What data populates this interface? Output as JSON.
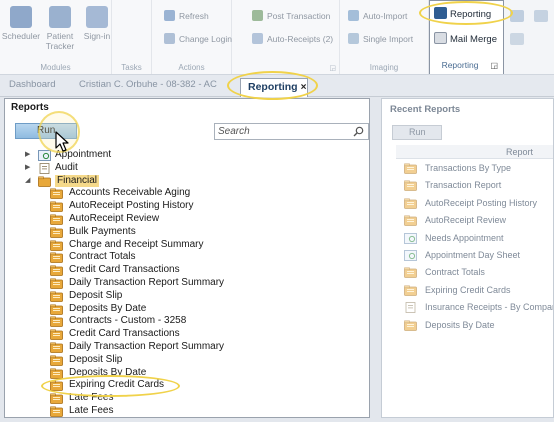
{
  "ribbon": {
    "groups": [
      {
        "label": "Modules",
        "buttons": [
          "Scheduler",
          "Patient Tracker",
          "Sign-in"
        ]
      },
      {
        "label": "Tasks"
      },
      {
        "label": "Actions",
        "items": [
          "Refresh",
          "Change Login"
        ]
      },
      {
        "label": "",
        "items": [
          "Post Transaction",
          "Auto-Receipts (2)"
        ]
      },
      {
        "label": "Imaging",
        "items": [
          "Auto-Import",
          "Single Import"
        ]
      }
    ],
    "reporting_group": {
      "label": "Reporting",
      "reporting_button": "Reporting",
      "mail_merge_button": "Mail Merge"
    }
  },
  "tabbar": {
    "crumbs": [
      "Dashboard",
      "Cristian C. Orbuhe - 08-382 - AC"
    ],
    "active_tab": "Reporting",
    "close_glyph": "×"
  },
  "reports": {
    "title": "Reports",
    "run_label": "Run",
    "search_placeholder": "Search",
    "tree": [
      {
        "label": "Appointment",
        "level": 1,
        "toggle": "▶",
        "icon": "appointment-icon"
      },
      {
        "label": "Audit",
        "level": 1,
        "toggle": "▶",
        "icon": "audit-icon"
      },
      {
        "label": "Financial",
        "level": 1,
        "toggle": "◢",
        "icon": "folder-icon"
      },
      {
        "label": "Accounts Receivable Aging",
        "level": 2,
        "icon": "report-icon"
      },
      {
        "label": "AutoReceipt Posting History",
        "level": 2,
        "icon": "report-icon"
      },
      {
        "label": "AutoReceipt Review",
        "level": 2,
        "icon": "report-icon"
      },
      {
        "label": "Bulk Payments",
        "level": 2,
        "icon": "report-icon"
      },
      {
        "label": "Charge and Receipt Summary",
        "level": 2,
        "icon": "report-icon"
      },
      {
        "label": "Contract Totals",
        "level": 2,
        "icon": "report-icon"
      },
      {
        "label": "Credit Card Transactions",
        "level": 2,
        "icon": "report-icon"
      },
      {
        "label": "Daily Transaction Report Summary",
        "level": 2,
        "icon": "report-icon"
      },
      {
        "label": "Deposit Slip",
        "level": 2,
        "icon": "report-icon"
      },
      {
        "label": "Deposits By Date",
        "level": 2,
        "icon": "report-icon"
      },
      {
        "label": "Contracts - Custom - 3258",
        "level": 2,
        "icon": "report-icon"
      },
      {
        "label": "Credit Card Transactions",
        "level": 2,
        "icon": "report-icon"
      },
      {
        "label": "Daily Transaction Report Summary",
        "level": 2,
        "icon": "report-icon"
      },
      {
        "label": "Deposit Slip",
        "level": 2,
        "icon": "report-icon"
      },
      {
        "label": "Deposits By Date",
        "level": 2,
        "icon": "report-icon"
      },
      {
        "label": "Expiring Credit Cards",
        "level": 2,
        "icon": "report-icon"
      },
      {
        "label": "Late Fees",
        "level": 2,
        "icon": "report-icon"
      },
      {
        "label": "Late Fees",
        "level": 2,
        "icon": "report-icon"
      }
    ]
  },
  "recent": {
    "title": "Recent Reports",
    "run_label": "Run",
    "column_header": "Report",
    "items": [
      "Transactions By Type",
      "Transaction Report",
      "AutoReceipt Posting History",
      "AutoReceipt Review",
      "Needs Appointment",
      "Appointment Day Sheet",
      "Contract Totals",
      "Expiring Credit Cards",
      "Insurance Receipts - By Company",
      "Deposits By Date"
    ]
  },
  "colors": {
    "callout": "#f0d24a",
    "run_button": "#a9cbe9",
    "accent_text": "#1f3f63",
    "folder": "#e8a83a"
  }
}
